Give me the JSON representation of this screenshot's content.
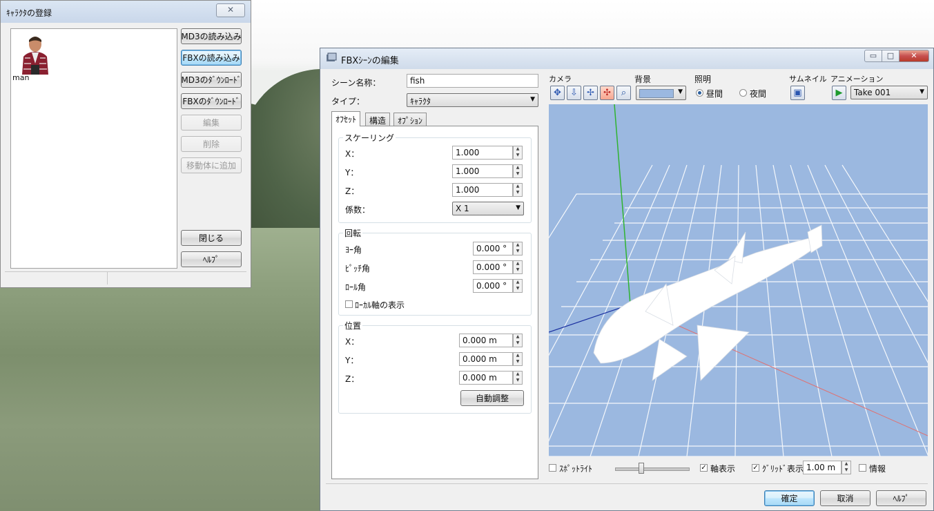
{
  "char_window": {
    "title": "ｷｬﾗｸﾀの登録",
    "close_label": "✕",
    "character": {
      "name": "man"
    },
    "buttons": {
      "md3_load": "MD3の読み込み",
      "fbx_load": "FBXの読み込み",
      "md3_download": "MD3のﾀﾞｳﾝﾛｰﾄﾞ",
      "fbx_download": "FBXのﾀﾞｳﾝﾛｰﾄﾞ",
      "edit": "編集",
      "delete": "削除",
      "add_to_moving": "移動体に追加",
      "close": "閉じる",
      "help": "ﾍﾙﾌﾟ"
    }
  },
  "fbx_window": {
    "title": "FBXｼｰﾝの編集",
    "window_buttons": {
      "minimize": "▭",
      "maximize": "□",
      "close": "✕"
    },
    "scene_name_label": "シーン名称：",
    "scene_name_value": "fish",
    "type_label": "タイプ：",
    "type_value": "ｷｬﾗｸﾀ",
    "tabs": [
      "ｵﾌｾｯﾄ",
      "構造",
      "ｵﾌﾟｼｮﾝ"
    ],
    "scaling": {
      "title": "スケーリング",
      "x_label": "X：",
      "x_value": "1.000",
      "y_label": "Y：",
      "y_value": "1.000",
      "z_label": "Z：",
      "z_value": "1.000",
      "factor_label": "係数：",
      "factor_value": "X 1"
    },
    "rotation": {
      "title": "回転",
      "yaw_label": "ﾖｰ角",
      "yaw_value": "0.000 °",
      "pitch_label": "ﾋﾟｯﾁ角",
      "pitch_value": "0.000 °",
      "roll_label": "ﾛｰﾙ角",
      "roll_value": "0.000 °",
      "local_axis_label": "ﾛｰｶﾙ軸の表示"
    },
    "position": {
      "title": "位置",
      "x_label": "X：",
      "x_value": "0.000 m",
      "y_label": "Y：",
      "y_value": "0.000 m",
      "z_label": "Z：",
      "z_value": "0.000 m",
      "auto_adjust": "自動調整"
    },
    "toolbar": {
      "camera_label": "カメラ",
      "background_label": "背景",
      "lighting_label": "照明",
      "daytime_label": "昼間",
      "night_label": "夜間",
      "thumbnail_label": "サムネイル",
      "animation_label": "アニメーション",
      "animation_value": "Take 001",
      "camera_buttons": [
        "rotate-icon",
        "down-arrow-icon",
        "pan-icon",
        "orbit-icon",
        "zoom-icon"
      ],
      "background_color": "#9bb8e0"
    },
    "bottom": {
      "spotlight_label": "ｽﾎﾟｯﾄﾗｲﾄ",
      "axis_display_label": "軸表示",
      "grid_display_label": "ｸﾞﾘｯﾄﾞ表示",
      "grid_size_value": "1.00 m",
      "info_label": "情報"
    },
    "dialog_buttons": {
      "ok": "確定",
      "cancel": "取消",
      "help": "ﾍﾙﾌﾟ"
    }
  }
}
